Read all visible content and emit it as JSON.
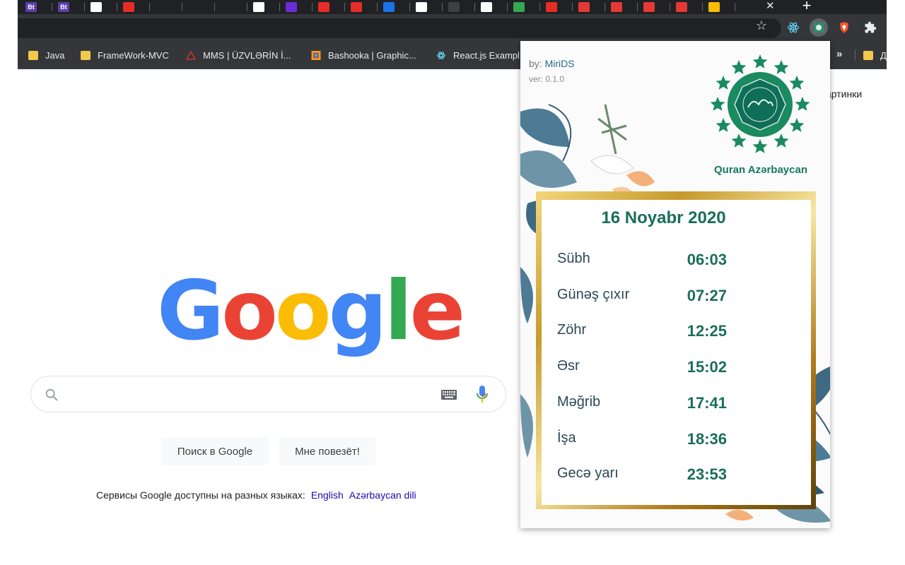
{
  "tabs": [
    {
      "icon": "bt-icon",
      "label": "Bt",
      "color": "#5b3fa8"
    },
    {
      "icon": "bt-icon",
      "label": "Bt",
      "color": "#5b3fa8"
    },
    {
      "icon": "page-icon",
      "label": "",
      "color": "#ffffff"
    },
    {
      "icon": "youtube-icon",
      "label": "",
      "color": "#e52d27"
    },
    {
      "icon": "github-icon",
      "label": "",
      "color": "#202124"
    },
    {
      "icon": "github-icon",
      "label": "",
      "color": "#202124"
    },
    {
      "icon": "openai-icon",
      "label": "",
      "color": "#202124"
    },
    {
      "icon": "puzzle-icon",
      "label": "",
      "color": "#ffffff"
    },
    {
      "icon": "app-icon",
      "label": "",
      "color": "#6b2bd6"
    },
    {
      "icon": "youtube-icon",
      "label": "",
      "color": "#e52d27"
    },
    {
      "icon": "youtube-icon",
      "label": "",
      "color": "#e52d27"
    },
    {
      "icon": "bag-icon",
      "label": "",
      "color": "#1a73e8"
    },
    {
      "icon": "google-icon",
      "label": "",
      "color": "#ffffff"
    },
    {
      "icon": "info-icon",
      "label": "",
      "color": "#3c4043"
    },
    {
      "icon": "dark-icon",
      "label": "",
      "color": "#ffffff"
    },
    {
      "icon": "chrome-icon",
      "label": "",
      "color": "#34a853"
    },
    {
      "icon": "youtube-icon",
      "label": "",
      "color": "#e52d27"
    },
    {
      "icon": "red-icon",
      "label": "",
      "color": "#e53935"
    },
    {
      "icon": "red-icon",
      "label": "",
      "color": "#e53935"
    },
    {
      "icon": "red-icon",
      "label": "",
      "color": "#e53935"
    },
    {
      "icon": "red-icon",
      "label": "",
      "color": "#e53935"
    },
    {
      "icon": "colorful-icon",
      "label": "",
      "color": "#fbbc05"
    }
  ],
  "toolbar": {
    "extensions": [
      "react-icon",
      "quran-extension-icon",
      "brave-icon",
      "puzzle-icon"
    ]
  },
  "bookmarks": [
    {
      "label": "Java",
      "icon": "folder-icon"
    },
    {
      "label": "FrameWork-MVC",
      "icon": "folder-icon"
    },
    {
      "label": "MMS | ÜZVLƏRİN İ...",
      "icon": "triangle-icon"
    },
    {
      "label": "Bashooka | Graphic...",
      "icon": "grid-icon"
    },
    {
      "label": "React.js Exampl",
      "icon": "react-icon"
    }
  ],
  "bookmarks_more": "»",
  "bookmark_tail_label": "Д",
  "google": {
    "images_link": "артинки",
    "logo": [
      "G",
      "o",
      "o",
      "g",
      "l",
      "e"
    ],
    "logo_colors": [
      "#4285f4",
      "#ea4335",
      "#fbbc05",
      "#4285f4",
      "#34a853",
      "#ea4335"
    ],
    "search_button": "Поиск в Google",
    "lucky_button": "Мне повезёт!",
    "languages_prefix": "Сервисы Google доступны на разных языках:",
    "languages": [
      "English",
      "Azərbaycan dili"
    ]
  },
  "popup": {
    "by_prefix": "by:",
    "author": "MiriDS",
    "version": "ver: 0.1.0",
    "brand": "Quran Azərbaycan",
    "date": "16 Noyabr 2020",
    "prayers": [
      {
        "name": "Sübh",
        "time": "06:03"
      },
      {
        "name": "Günəş çıxır",
        "time": "07:27"
      },
      {
        "name": "Zöhr",
        "time": "12:25"
      },
      {
        "name": "Əsr",
        "time": "15:02"
      },
      {
        "name": "Məğrib",
        "time": "17:41"
      },
      {
        "name": "İşa",
        "time": "18:36"
      },
      {
        "name": "Gecə yarı",
        "time": "23:53"
      }
    ]
  }
}
